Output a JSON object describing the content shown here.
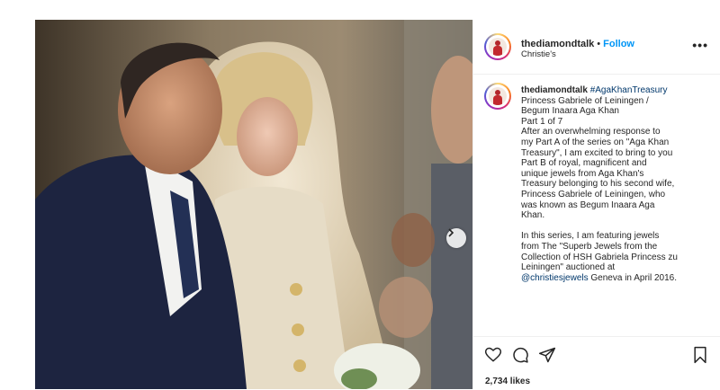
{
  "post": {
    "username": "thediamondtalk",
    "separator": "•",
    "follow_label": "Follow",
    "location": "Christie's",
    "more_label": "•••"
  },
  "caption": {
    "username": "thediamondtalk",
    "hashtag": "#AgaKhanTreasury",
    "lines": [
      "Princess Gabriele of Leiningen /",
      "Begum Inaara Aga Khan",
      "Part 1 of 7",
      "After an overwhelming response to",
      "my Part A of the series on \"Aga Khan",
      "Treasury\", I am excited to bring to you",
      "Part B of royal, magnificent and",
      "unique jewels from Aga Khan's",
      "Treasury belonging to his second wife,",
      "Princess Gabriele of Leiningen, who",
      "was known as Begum Inaara Aga",
      "Khan.",
      "",
      "In this series, I am featuring jewels",
      "from The \"Superb Jewels from the",
      "Collection of HSH Gabriela Princess zu",
      "Leiningen\" auctioned at"
    ],
    "mention": "@christiesjewels",
    "last_line_rest": " Geneva in April 2016."
  },
  "actions": {
    "likes": "2,734 likes"
  },
  "icons": {
    "like": "heart-icon",
    "comment": "comment-icon",
    "share": "share-icon",
    "save": "bookmark-icon",
    "next": "chevron-right-icon",
    "more": "more-horizontal-icon"
  },
  "colors": {
    "link_blue": "#0095f6",
    "hashtag": "#00376b",
    "text": "#262626",
    "border": "#efefef"
  }
}
